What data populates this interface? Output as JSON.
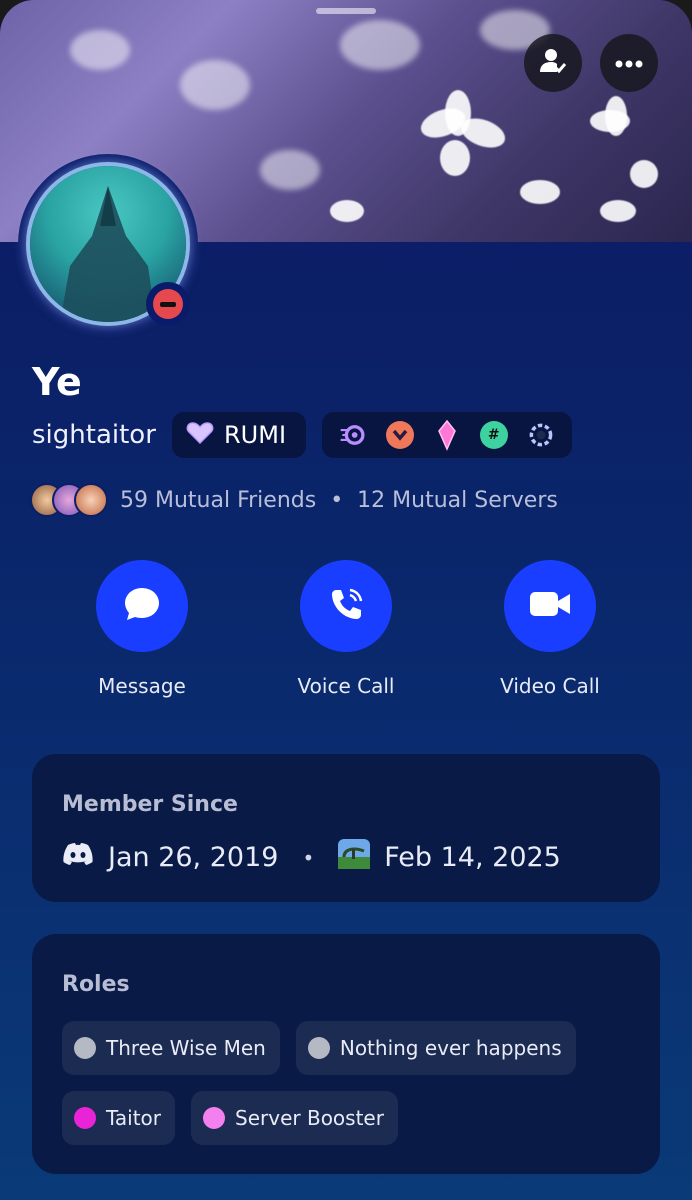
{
  "profile": {
    "display_name": "Ye",
    "username": "sightaitor",
    "tag_label": "RUMI",
    "status": "do-not-disturb"
  },
  "badges": [
    {
      "icon": "nitro-icon",
      "color": "#b98cff"
    },
    {
      "icon": "boost-chevron-icon",
      "color": "#f0785a"
    },
    {
      "icon": "gem-icon",
      "color": "#ff78d8"
    },
    {
      "icon": "hashtag-icon",
      "color": "#3fd2a1"
    },
    {
      "icon": "laurel-icon",
      "color": "#b8c6ff"
    }
  ],
  "mutuals": {
    "friends": "59 Mutual Friends",
    "separator": "•",
    "servers": "12 Mutual Servers"
  },
  "actions": {
    "message": "Message",
    "voice_call": "Voice Call",
    "video_call": "Video Call"
  },
  "member_since": {
    "title": "Member Since",
    "discord_date": "Jan 26, 2019",
    "separator": "•",
    "server_date": "Feb 14, 2025"
  },
  "roles": {
    "title": "Roles",
    "items": [
      {
        "name": "Three Wise Men",
        "color": "#b5b9c4"
      },
      {
        "name": "Nothing ever happens",
        "color": "#b5b9c4"
      },
      {
        "name": "Taitor",
        "color": "#e824d6"
      },
      {
        "name": "Server Booster",
        "color": "#f47fef"
      }
    ]
  },
  "colors": {
    "accent": "#1a3eff",
    "background": "#0b1f66",
    "card": "#081a45"
  }
}
